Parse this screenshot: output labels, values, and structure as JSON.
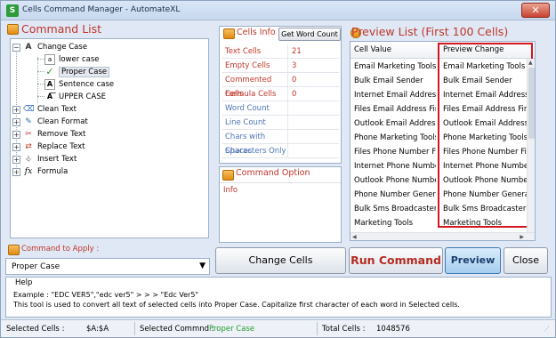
{
  "window": {
    "title": "Cells Command Manager - AutomateXL",
    "close": "✕"
  },
  "command_list": {
    "title": "Command List",
    "tree": [
      {
        "label": "Change Case",
        "expanded": true,
        "icon": "change-case-icon"
      },
      {
        "label": "lower case",
        "icon": "lower-case-icon"
      },
      {
        "label": "Proper Case",
        "icon": "checkmark-icon",
        "selected": true
      },
      {
        "label": "Sentence case",
        "icon": "sentence-case-icon"
      },
      {
        "label": "UPPER CASE",
        "icon": "upper-case-icon"
      },
      {
        "label": "Clean Text",
        "icon": "clean-text-icon"
      },
      {
        "label": "Clean Format",
        "icon": "clean-format-icon"
      },
      {
        "label": "Remove Text",
        "icon": "remove-text-icon"
      },
      {
        "label": "Replace Text",
        "icon": "replace-text-icon"
      },
      {
        "label": "Insert Text",
        "icon": "insert-text-icon"
      },
      {
        "label": "Formula",
        "icon": "formula-icon"
      }
    ]
  },
  "apply": {
    "label": "Command to Apply :",
    "value": "Proper Case"
  },
  "cells_info": {
    "title": "Cells Info",
    "word_count_button": "Get Word Count",
    "rows": [
      {
        "label": "Text Cells",
        "value": "21"
      },
      {
        "label": "Empty Cells",
        "value": "3"
      },
      {
        "label": "Commented Cells",
        "value": "0"
      },
      {
        "label": "Formula Cells",
        "value": "0"
      },
      {
        "label": "Word Count",
        "value": ""
      },
      {
        "label": "Line Count",
        "value": ""
      },
      {
        "label": "Chars with Spaces",
        "value": ""
      },
      {
        "label": "Characters Only",
        "value": ""
      }
    ]
  },
  "command_option": {
    "title": "Command Option",
    "info": "Info"
  },
  "preview": {
    "title": "Preview List (First 100 Cells)",
    "col_cell_value": "Cell Value",
    "col_preview": "Preview Change",
    "rows": [
      {
        "value": "Email Marketing Tools",
        "preview": "Email Marketing Tools"
      },
      {
        "value": "Bulk Email Sender",
        "preview": "Bulk Email Sender"
      },
      {
        "value": "Internet Email Address F...",
        "preview": "Internet Email Address Fi..."
      },
      {
        "value": "Files Email Address Finder",
        "preview": "Files Email Address Finder"
      },
      {
        "value": "Outlook Email Address Fi...",
        "preview": "Outlook Email Address Fi..."
      },
      {
        "value": "Phone Marketing Tools",
        "preview": "Phone Marketing Tools"
      },
      {
        "value": "Files Phone Number Fin...",
        "preview": "Files Phone Number Finder"
      },
      {
        "value": "Internet Phone Number ...",
        "preview": "Internet Phone Number F..."
      },
      {
        "value": "Outlook Phone Number ...",
        "preview": "Outlook Phone Number Fi..."
      },
      {
        "value": "Phone Number Generator",
        "preview": "Phone Number Generator"
      },
      {
        "value": "Bulk Sms Broadcaster G...",
        "preview": "Bulk Sms Broadcaster Gs..."
      },
      {
        "value": "Marketing Tools",
        "preview": "Marketing Tools"
      }
    ]
  },
  "buttons": {
    "change_cells": "Change Cells",
    "run_command": "Run Command",
    "preview": "Preview",
    "close": "Close"
  },
  "help": {
    "title": "Help",
    "example": "Example : \"EDC VER5\",\"edc ver5\" > > >  \"Edc Ver5\"",
    "description": "This tool is used to convert all text of selected cells into Proper Case. Capitalize first character of each word in Selected cells."
  },
  "status": {
    "selected_cells_label": "Selected Cells :",
    "selected_cells_value": "$A:$A",
    "selected_command_label": "Selected Commnd :",
    "selected_command_value": "Proper Case",
    "total_cells_label": "Total Cells :",
    "total_cells_value": "1048576"
  },
  "colors": {
    "accent_red": "#c0352b",
    "link_blue": "#4e74b5",
    "highlight_box": "#d2171f",
    "status_green": "#1f9a2e"
  }
}
